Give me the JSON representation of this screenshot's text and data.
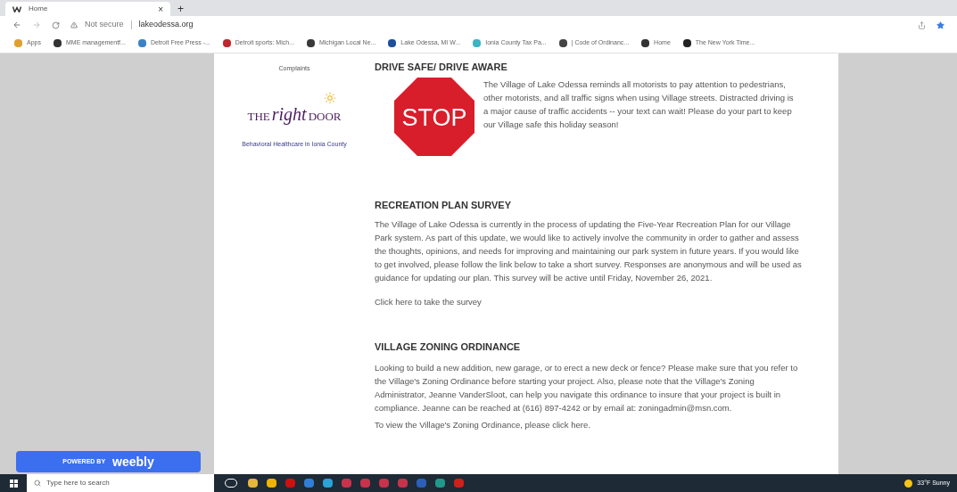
{
  "browser": {
    "tab": {
      "title": "Home",
      "close": "×",
      "new_tab": "+"
    },
    "address": {
      "security": "Not secure",
      "url": "lakeodessa.org"
    },
    "bookmarks": [
      {
        "label": "Apps",
        "color": "#e0a030"
      },
      {
        "label": "MME managementf...",
        "color": "#333333"
      },
      {
        "label": "Detroit Free Press -...",
        "color": "#3b82c4"
      },
      {
        "label": "Detroit sports: Mich...",
        "color": "#c0262d"
      },
      {
        "label": "Michigan Local Ne...",
        "color": "#3a3a3a"
      },
      {
        "label": "Lake Odessa, MI W...",
        "color": "#1f4e9c"
      },
      {
        "label": "Ionia County Tax Pa...",
        "color": "#3bb3c3"
      },
      {
        "label": "| Code of Ordinanc...",
        "color": "#444444"
      },
      {
        "label": "Home",
        "color": "#333333"
      },
      {
        "label": "The New York Time...",
        "color": "#222222"
      }
    ]
  },
  "page": {
    "sidebar": {
      "complaints": "Complaints",
      "logo": {
        "word_1": "THE",
        "word_2": "right",
        "word_3": "DOOR"
      },
      "caption": "Behavioral Healthcare in Ionia County",
      "powered_by": "POWERED BY",
      "brand": "weebly"
    },
    "sections": [
      {
        "heading": "DRIVE SAFE/ DRIVE AWARE",
        "sign": "STOP",
        "body": "The Village of Lake Odessa reminds all motorists to pay attention to pedestrians, other motorists, and all traffic signs when using Village streets. Distracted driving is a major cause of traffic accidents -- your text can wait! Please do your part to keep our Village safe this holiday season!"
      },
      {
        "heading": "RECREATION PLAN SURVEY",
        "body": "The Village of Lake Odessa is currently in the process of updating the Five-Year Recreation Plan for our Village Park system. As part of this update, we would like to actively involve the community in order to gather and assess the thoughts, opinions, and needs for improving and maintaining our park system in future years. If you would like to get involved, please follow the link below to take a short survey. Responses are anonymous and will be used as guidance for updating our plan. This survey will be active until Friday, November 26, 2021.",
        "link": "Click here to take the survey"
      },
      {
        "heading": "VILLAGE ZONING ORDINANCE",
        "body": "Looking to build a new addition, new garage, or to erect a new deck or fence? Please make sure that you refer to the Village's Zoning Ordinance before starting your project. Also, please note that the Village's Zoning Administrator, Jeanne VanderSloot, can help you navigate this ordinance to insure that your project is built in compliance. Jeanne can be reached at (616) 897-4242 or by email at: zoningadmin@msn.com.",
        "link": "To view the Village's Zoning Ordinance, please click here."
      }
    ]
  },
  "taskbar": {
    "search_placeholder": "Type here to search",
    "apps": [
      {
        "color": "#e5b73b"
      },
      {
        "color": "#f0b400"
      },
      {
        "color": "#cc1010"
      },
      {
        "color": "#2f7fd6"
      },
      {
        "color": "#2aa3d8"
      },
      {
        "color": "#c8334b"
      },
      {
        "color": "#c8334b"
      },
      {
        "color": "#c8334b"
      },
      {
        "color": "#c8334b"
      },
      {
        "color": "#2b5fb8"
      },
      {
        "color": "#1f9a8a"
      },
      {
        "color": "#d0201a"
      }
    ],
    "weather": "33°F Sunny"
  }
}
